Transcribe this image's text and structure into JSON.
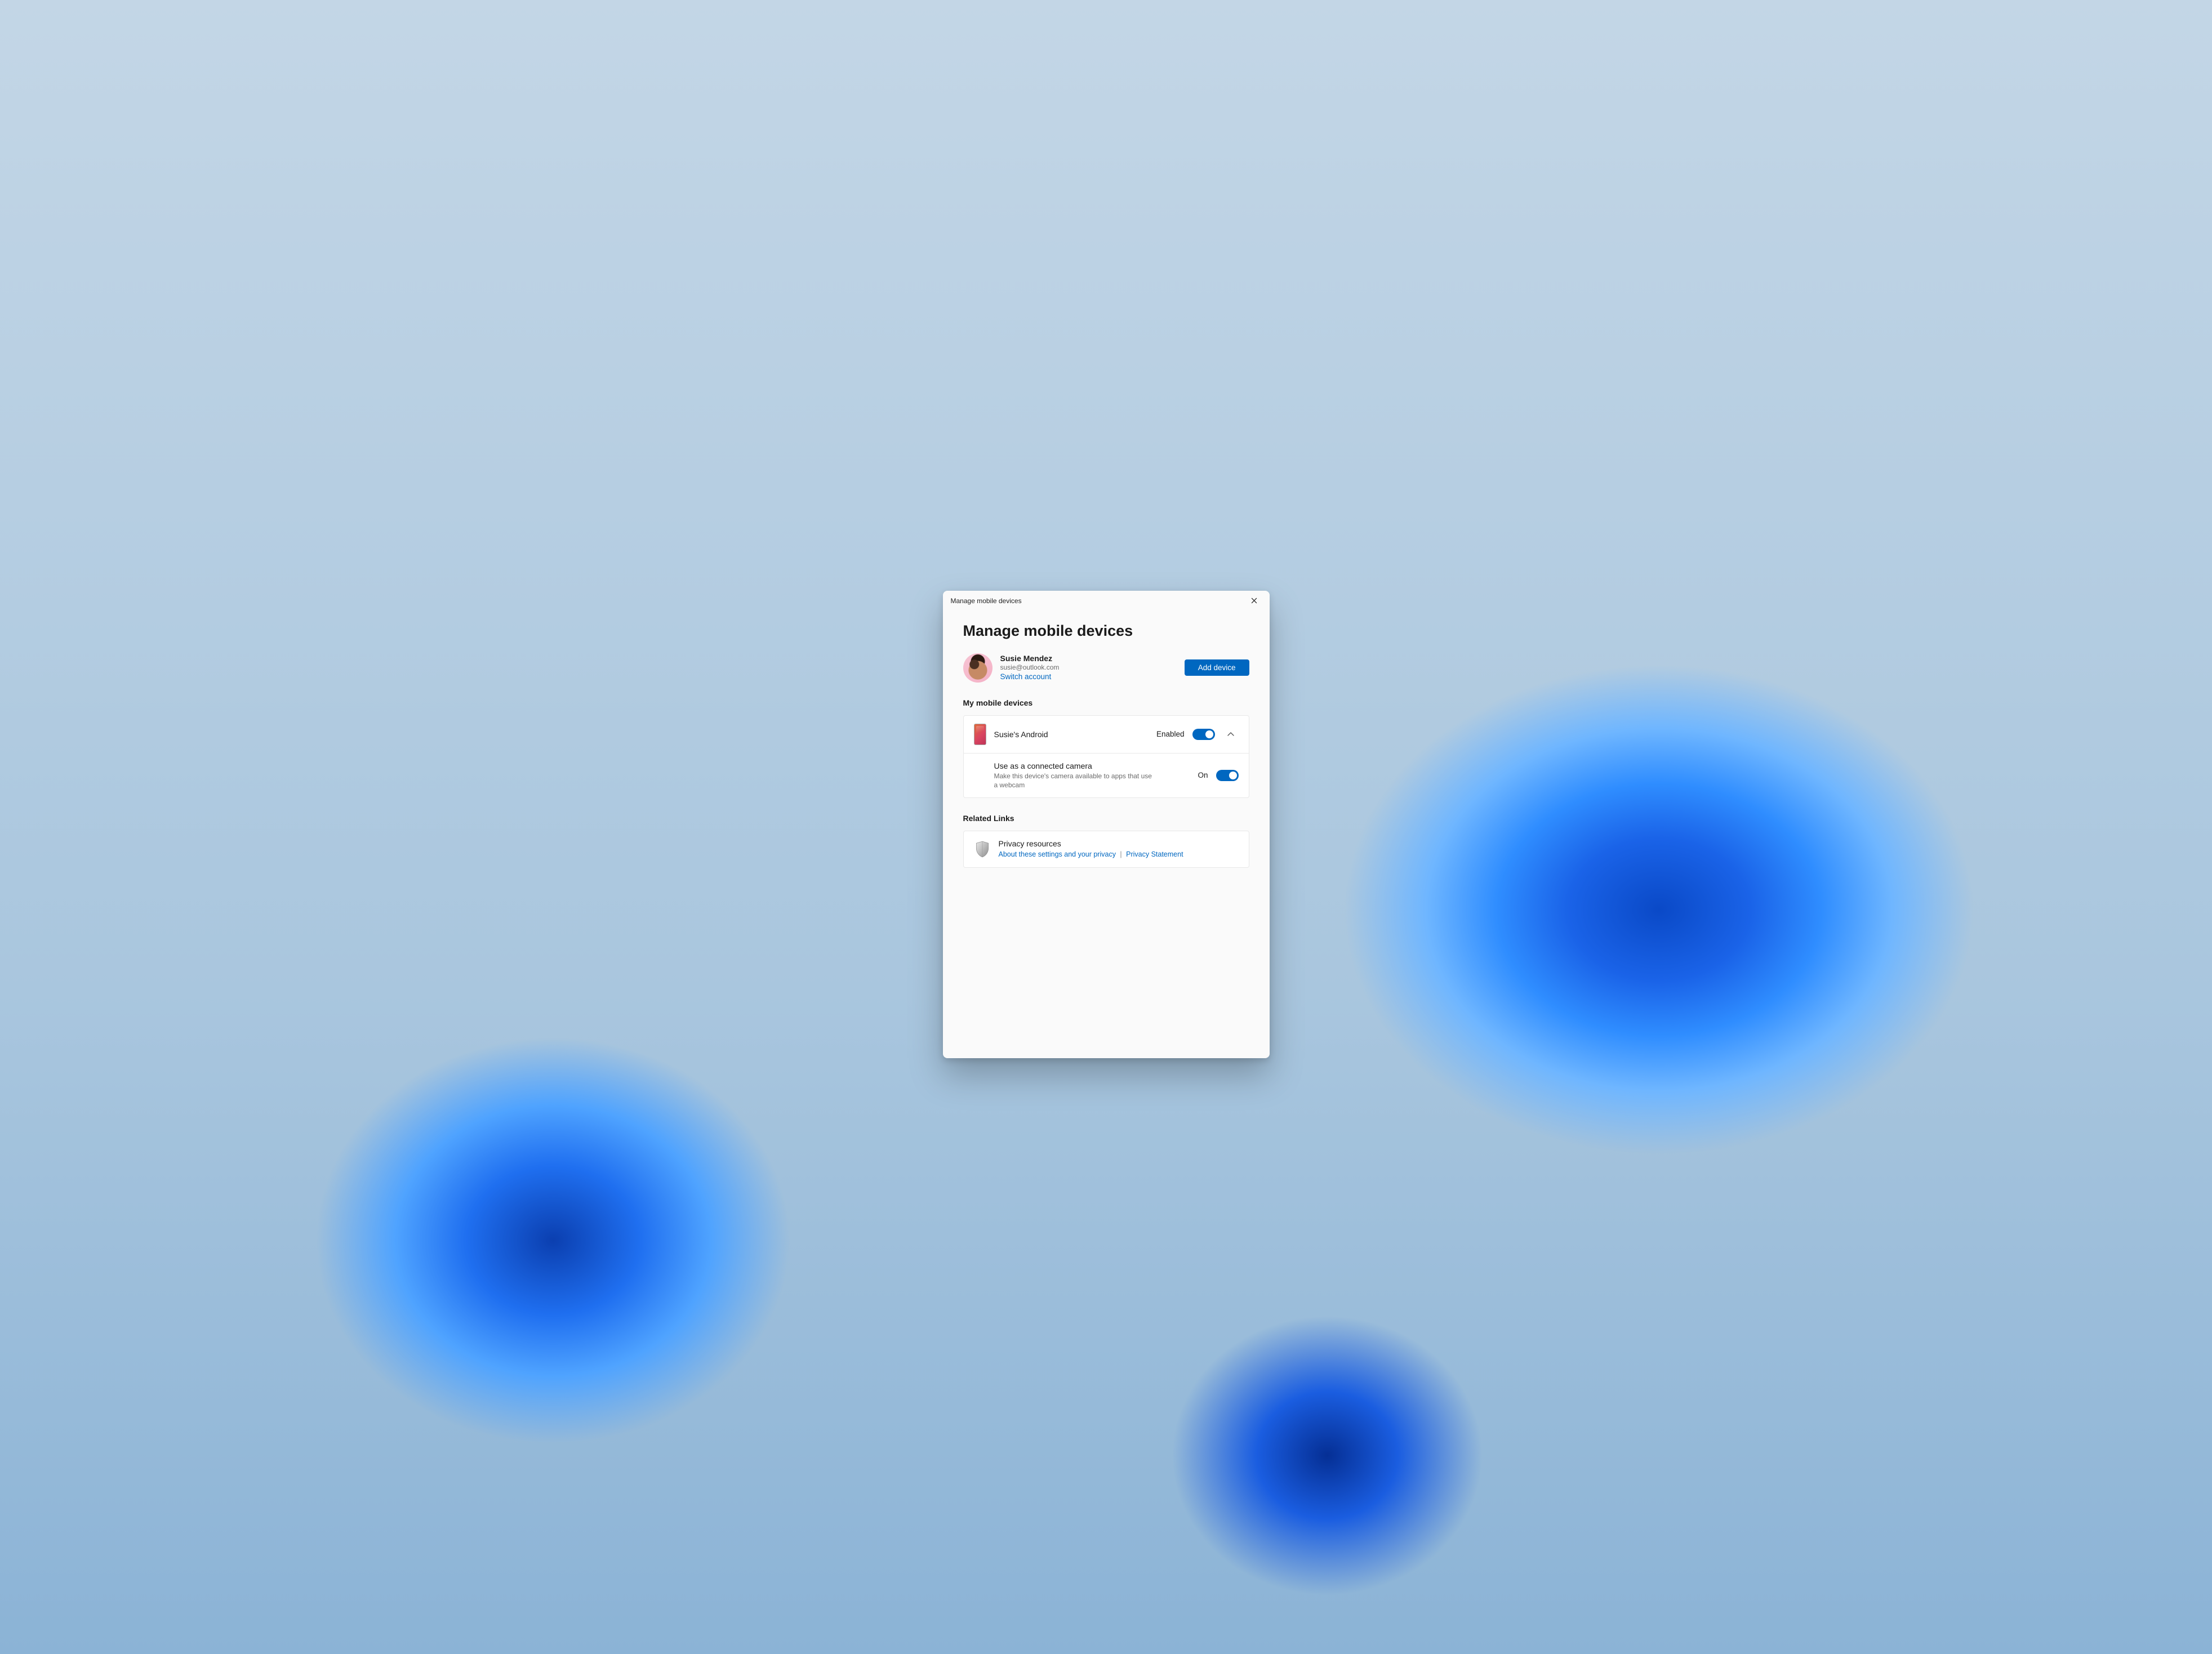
{
  "window": {
    "title": "Manage mobile devices"
  },
  "page": {
    "heading": "Manage mobile devices"
  },
  "user": {
    "name": "Susie Mendez",
    "email": "susie@outlook.com",
    "switch_label": "Switch account"
  },
  "actions": {
    "add_device": "Add device"
  },
  "sections": {
    "devices_label": "My mobile devices",
    "related_label": "Related Links"
  },
  "device": {
    "name": "Susie's Android",
    "enabled_label": "Enabled",
    "camera": {
      "title": "Use as a connected camera",
      "desc": "Make this device's camera available to apps that use a webcam",
      "state": "On"
    }
  },
  "privacy": {
    "title": "Privacy resources",
    "link1": "About these settings and your privacy",
    "separator": "|",
    "link2": "Privacy Statement"
  }
}
